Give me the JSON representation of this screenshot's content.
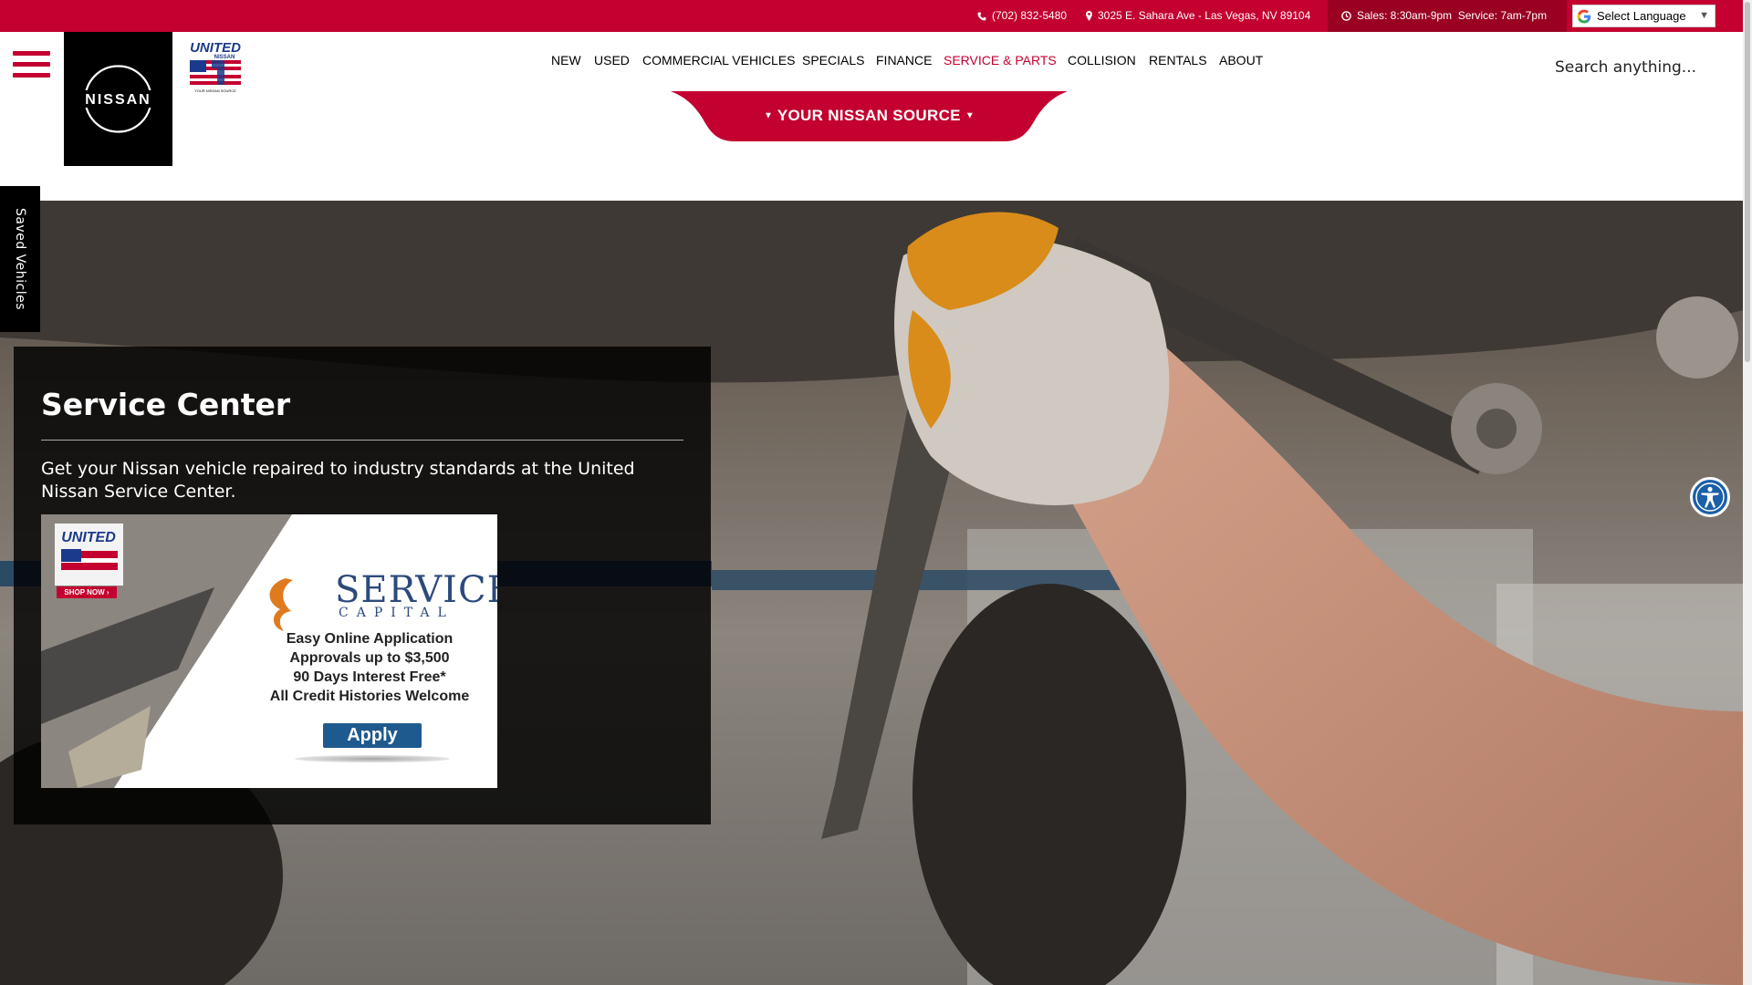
{
  "topbar": {
    "phone": "(702) 832-5480",
    "address": "3025 E. Sahara Ave - Las Vegas, NV 89104",
    "hours": "Sales: 8:30am-9pm  Service: 7am-7pm",
    "language_label": "Select Language",
    "language_arrow": "▼"
  },
  "logo": {
    "brand": "NISSAN",
    "dealer_top": "UNITED",
    "dealer_sub": "NISSAN",
    "dealer_tagline": "YOUR NISSAN SOURCE"
  },
  "nav": {
    "items": [
      "NEW",
      "USED",
      "COMMERCIAL VEHICLES",
      "SPECIALS",
      "FINANCE",
      "SERVICE & PARTS",
      "COLLISION",
      "RENTALS",
      "ABOUT"
    ],
    "active": "SERVICE & PARTS"
  },
  "search": {
    "placeholder": "Search anything..."
  },
  "source_tab": {
    "label": "YOUR NISSAN SOURCE"
  },
  "saved_vehicles": {
    "label": "Saved Vehicles"
  },
  "hero": {
    "title": "Service Center",
    "description": "Get your Nissan vehicle repaired to industry standards at the United Nissan Service Center."
  },
  "ad": {
    "brand_head": "SERVICE",
    "brand_sub": "CAPITAL",
    "shop_now": "SHOP NOW ›",
    "lines": [
      "Easy Online Application",
      "Approvals up to $3,500",
      "90 Days Interest Free*",
      "All Credit Histories Welcome"
    ],
    "apply_label": "Apply"
  },
  "icons": {
    "phone": "phone-icon",
    "address": "map-pin-icon",
    "hours": "clock-icon",
    "google": "google-g-icon",
    "menu": "hamburger-menu-icon",
    "accessibility": "accessibility-icon"
  },
  "colors": {
    "brand_red": "#c3002f",
    "dark_red": "#9a0022",
    "panel_bg": "#000000",
    "accessibility_blue": "#1a5fa8",
    "ad_navy": "#2c4a7c",
    "apply_blue": "#1f5a8e"
  }
}
